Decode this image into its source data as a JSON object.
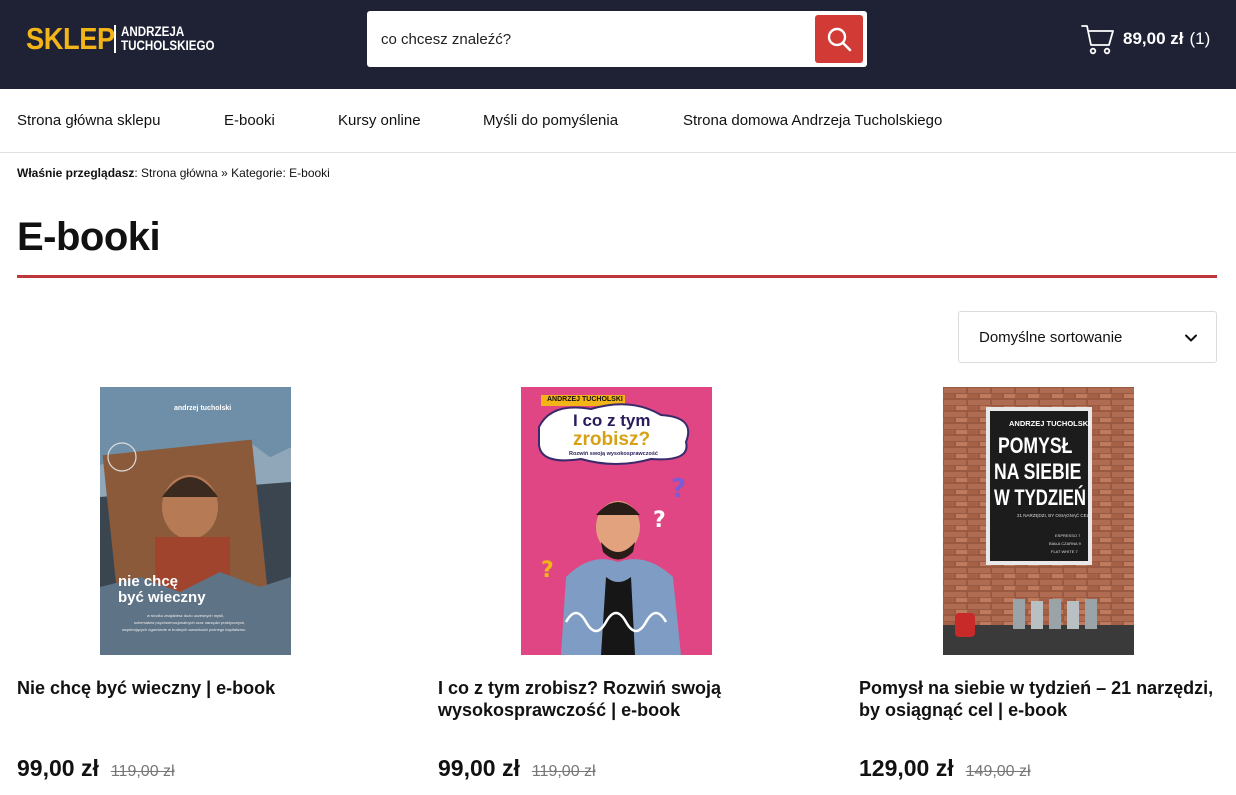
{
  "header": {
    "logo_main": "SKLEP",
    "logo_sub_line1": "ANDRZEJA",
    "logo_sub_line2": "TUCHOLSKIEGO",
    "search_placeholder": "co chcesz znaleźć?",
    "cart_amount": "89,00 zł",
    "cart_count": "(1)",
    "colors": {
      "background": "#1f2235",
      "logo_accent": "#f2b417",
      "search_button": "#d23a36"
    }
  },
  "nav": {
    "items": [
      {
        "label": "Strona główna sklepu"
      },
      {
        "label": "E-booki"
      },
      {
        "label": "Kursy online"
      },
      {
        "label": "Myśli do pomyślenia"
      },
      {
        "label": "Strona domowa Andrzeja Tucholskiego"
      }
    ]
  },
  "breadcrumb": {
    "prefix": "Właśnie przeglądasz",
    "path": ": Strona główna » Kategorie: E-booki"
  },
  "page": {
    "title": "E-booki",
    "rule_color": "#c0373a",
    "sort_label": "Domyślne sortowanie"
  },
  "products": [
    {
      "name": "Nie chcę być wieczny | e-book",
      "price": "99,00 zł",
      "old_price": "119,00 zł",
      "cover": {
        "author": "andrzej tucholski",
        "title_line1": "nie chcę",
        "title_line2": "być wieczny",
        "blurb1": "w środku znajdziesz dużo uczesnych myśli,",
        "blurb2": "schematów psychoemocjonalnych oraz narzędzi praktycznych,",
        "blurb3": "wspierających ogarnianie w trudnych warunkach późnego kapitalizmu"
      }
    },
    {
      "name": "I co z tym zrobisz? Rozwiń swoją wysokosprawczość | e-book",
      "price": "99,00 zł",
      "old_price": "119,00 zł",
      "cover": {
        "author": "ANDRZEJ TUCHOLSKI",
        "title_line1": "I co z tym",
        "title_line2": "zrobisz?",
        "subtitle": "Rozwiń swoją wysokosprawczość"
      }
    },
    {
      "name": "Pomysł na siebie w tydzień – 21 narzędzi, by osiągnąć cel | e-book",
      "price": "129,00 zł",
      "old_price": "149,00 zł",
      "cover": {
        "author": "ANDRZEJ TUCHOLSKI",
        "title_line1": "POMYSŁ",
        "title_line2": "NA SIEBIE",
        "title_line3": "W TYDZIEŃ",
        "subtitle": "21 NARZĘDZI, BY OSIĄGNĄĆ CEL",
        "menu1": "ESPRESSO  7",
        "menu2": "BIAŁA CZARNA  9",
        "menu3": "FLAT WHITE  7"
      }
    }
  ]
}
